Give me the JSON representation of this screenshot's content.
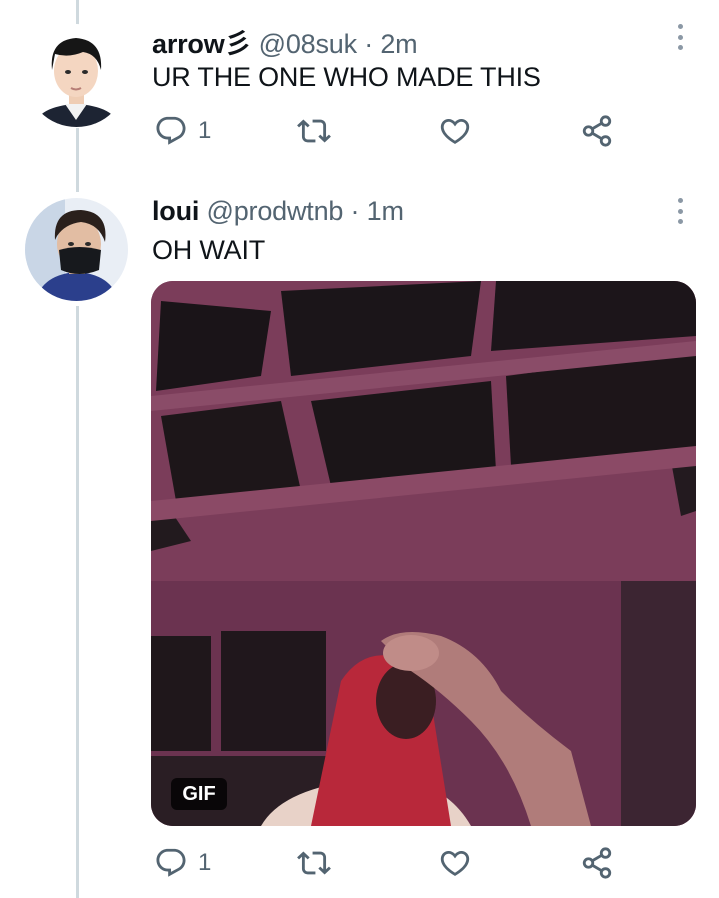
{
  "tweets": [
    {
      "name": "arrow彡",
      "handle": "@08suk",
      "separator": "·",
      "time": "2m",
      "text": "UR THE ONE WHO MADE THIS",
      "reply_count": "1"
    },
    {
      "name": "loui",
      "handle": "@prodwtnb",
      "separator": "·",
      "time": "1m",
      "text": "OH WAIT",
      "reply_count": "1",
      "media_badge": "GIF"
    }
  ],
  "icons": {
    "reply": "reply-icon",
    "retweet": "retweet-icon",
    "like": "heart-icon",
    "share": "share-icon",
    "more": "more-vertical-icon"
  },
  "colors": {
    "text_primary": "#0f1419",
    "text_secondary": "#536471",
    "thread_line": "#cfd9de",
    "media_tint": "#7a3a55"
  }
}
